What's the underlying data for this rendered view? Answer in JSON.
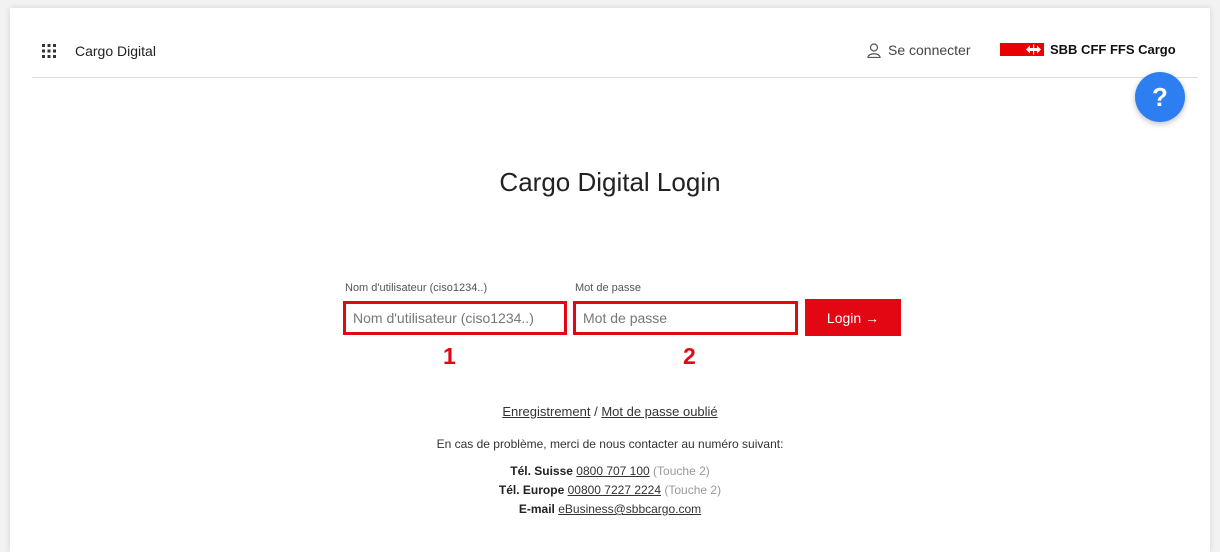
{
  "header": {
    "app_name": "Cargo Digital",
    "login_link": "Se connecter",
    "logo_text": "SBB CFF FFS Cargo"
  },
  "help": {
    "label": "?"
  },
  "main": {
    "title": "Cargo Digital Login",
    "username_label": "Nom d'utilisateur (ciso1234..)",
    "username_placeholder": "Nom d'utilisateur (ciso1234..)",
    "password_label": "Mot de passe",
    "password_placeholder": "Mot de passe",
    "submit_label": "Login →",
    "marker_1": "1",
    "marker_2": "2"
  },
  "links": {
    "register": "Enregistrement",
    "separator": " / ",
    "forgot_password": "Mot de passe oublié"
  },
  "contact": {
    "intro": "En cas de problème, merci de nous contacter au numéro suivant:",
    "ch_label": "Tél. Suisse",
    "ch_number": "0800 707 100",
    "ch_note": "(Touche 2)",
    "eu_label": "Tél. Europe",
    "eu_number": "00800 7227 2224",
    "eu_note": "(Touche 2)",
    "email_label": "E-mail",
    "email": "eBusiness@sbbcargo.com"
  },
  "colors": {
    "brand_red": "#e30613",
    "help_blue": "#2d7ff1"
  },
  "icons": {
    "apps": "grid-icon",
    "login": "user-icon",
    "help": "help-icon"
  }
}
